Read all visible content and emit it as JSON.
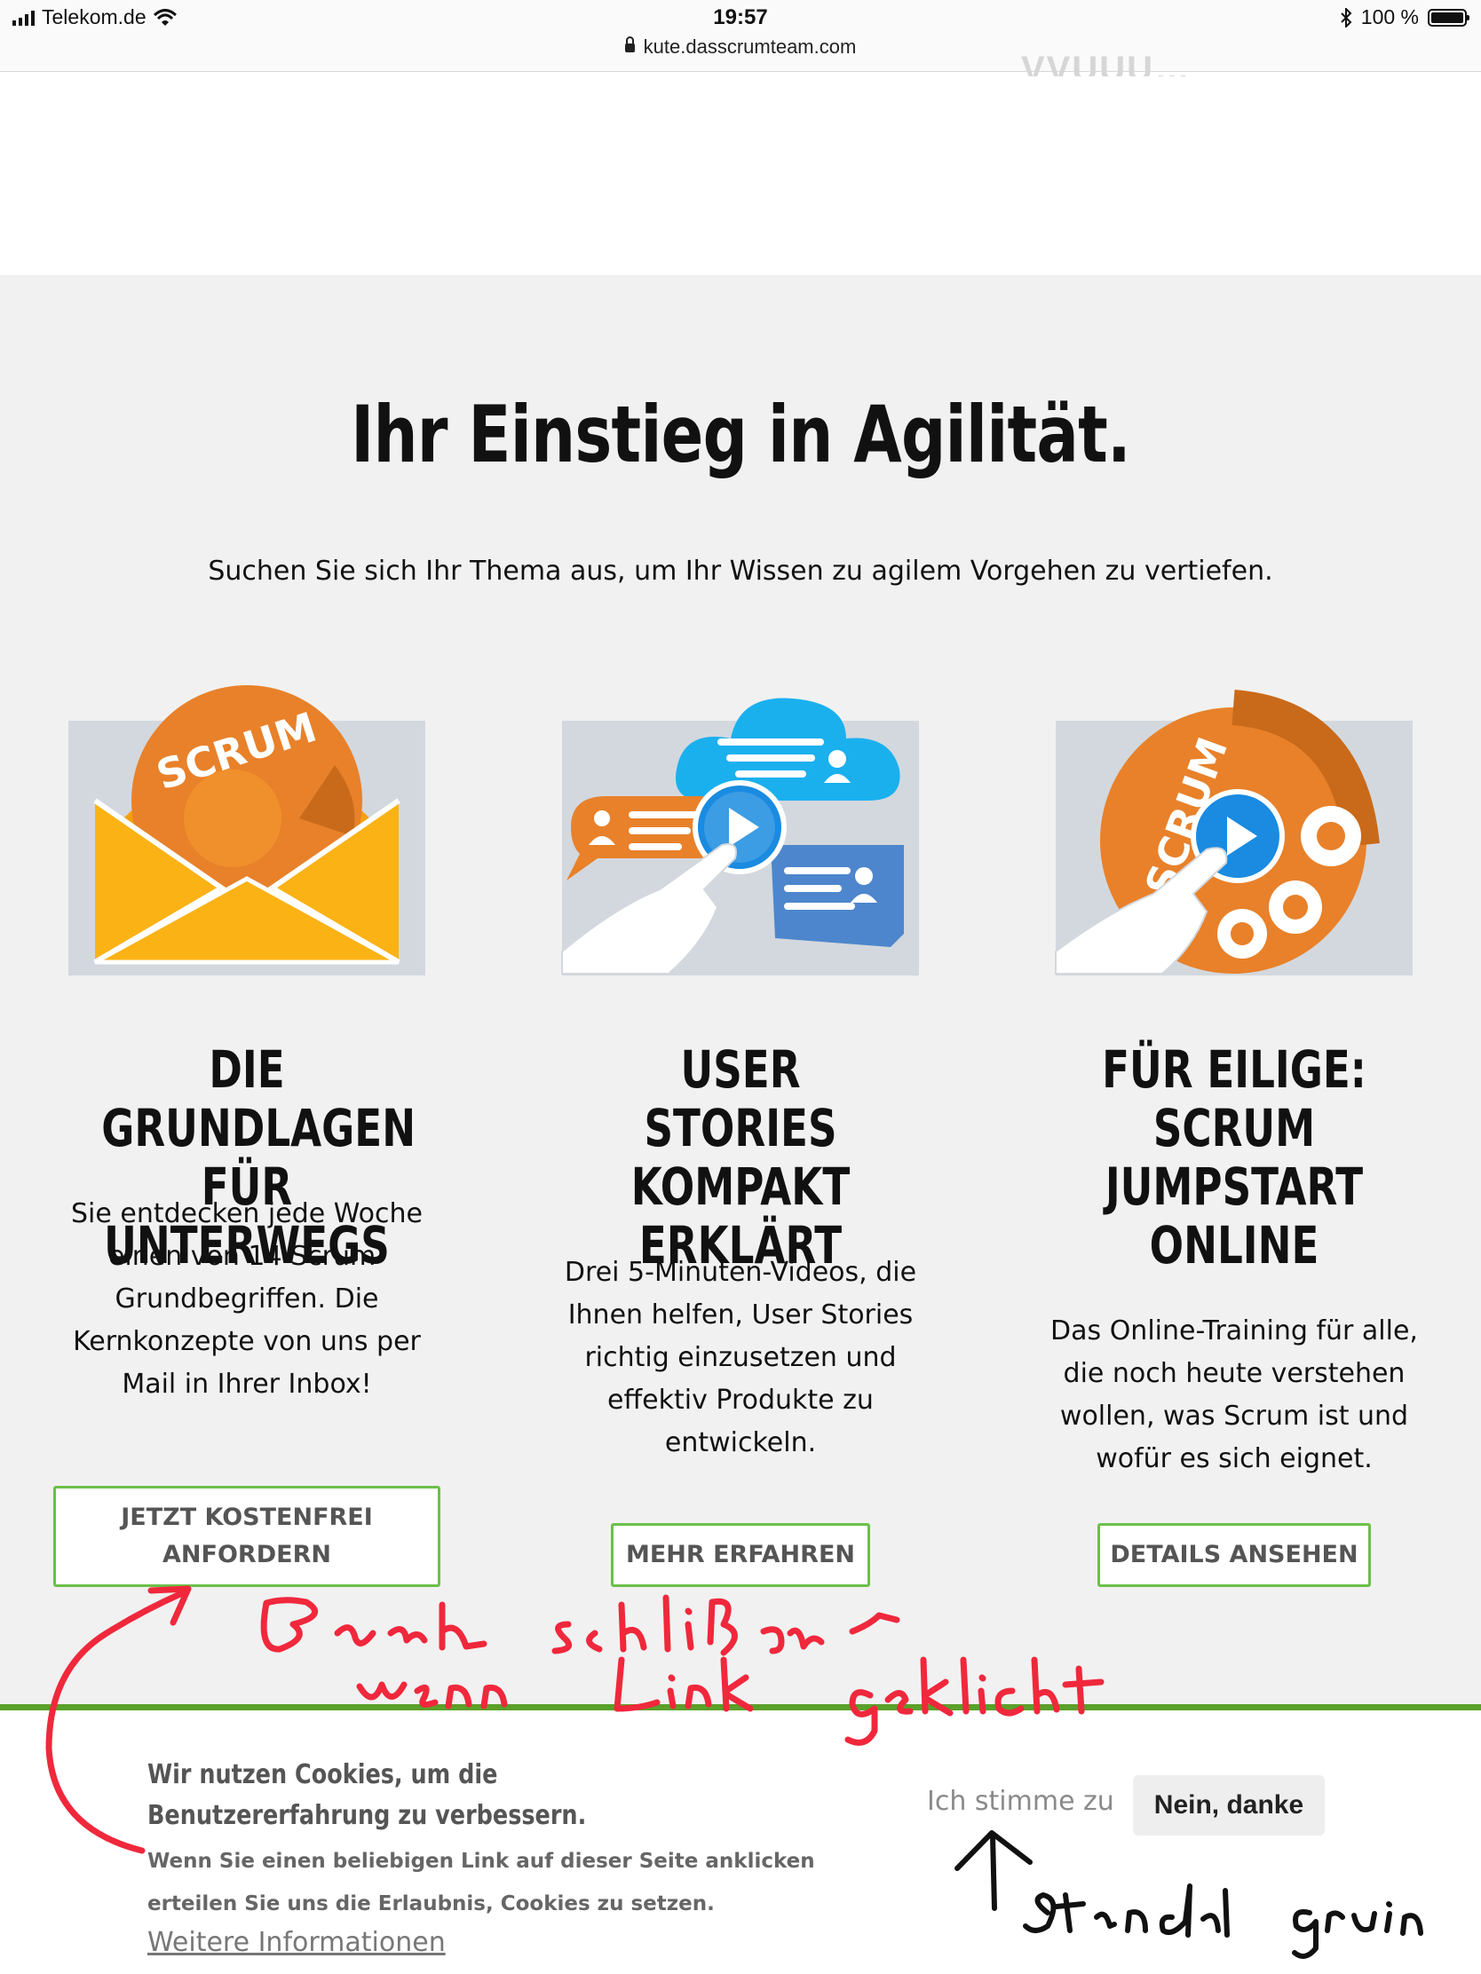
{
  "status_bar": {
    "carrier": "Telekom.de",
    "time": "19:57",
    "url": "kute.dasscrumteam.com",
    "battery": "100 %"
  },
  "hero": {
    "title": "Ihr Einstieg in Agilität.",
    "subtitle": "Suchen Sie sich Ihr Thema aus, um Ihr Wissen zu agilem Vorgehen zu vertiefen."
  },
  "cards": [
    {
      "title": "DIE GRUNDLAGEN FÜR UNTERWEGS",
      "text": "Sie entdecken jede Woche einen von 14 Scrum-Grundbegriffen. Die Kernkonzepte von uns per Mail in Ihrer Inbox!",
      "button": "JETZT KOSTENFREI ANFORDERN",
      "image_label": "SCRUM"
    },
    {
      "title": "USER STORIES KOMPAKT ERKLÄRT",
      "text": "Drei 5-Minuten-Videos, die Ihnen helfen, User Stories richtig einzusetzen und effektiv Produkte zu entwickeln.",
      "button": "MEHR ERFAHREN"
    },
    {
      "title": "FÜR EILIGE: SCRUM JUMPSTART ONLINE",
      "text": "Das Online-Training für alle, die noch heute verstehen wollen, was Scrum ist und wofür es sich eignet.",
      "button": "DETAILS ANSEHEN",
      "image_label": "SCRUM"
    }
  ],
  "cookie_banner": {
    "title": "Wir nutzen Cookies, um die Benutzererfahrung zu verbessern.",
    "text": "Wenn Sie einen beliebigen Link auf dieser Seite anklicken erteilen Sie uns die Erlaubnis, Cookies zu setzen.",
    "more_link": "Weitere Informationen",
    "agree_label": "Ich stimme zu",
    "decline_label": "Nein, danke"
  },
  "colors": {
    "button_border": "#6cc04a",
    "banner_border": "#5aa02a",
    "orange": "#e8812a",
    "yellow": "#fbb215",
    "blue": "#1aa3e8",
    "annotation_red": "#f0283c"
  }
}
